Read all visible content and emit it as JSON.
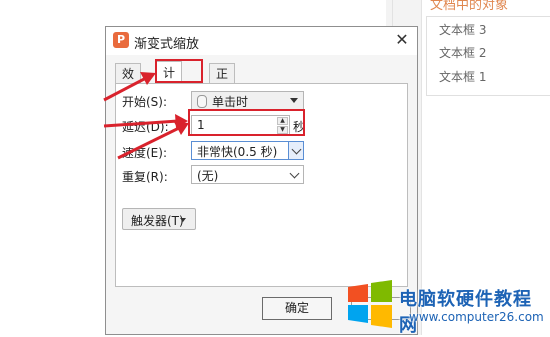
{
  "background": {
    "panel_title": "文档中的对象",
    "items": [
      "文本框 3",
      "文本框 2",
      "文本框 1"
    ]
  },
  "dialog": {
    "app_icon_glyph": "P",
    "title": "渐变式缩放",
    "close_glyph": "✕",
    "tabs": [
      {
        "label": "效果",
        "active": false
      },
      {
        "label": "计时",
        "active": true
      },
      {
        "label": "正文文本动画",
        "active": false
      }
    ],
    "start": {
      "label": "开始(S):",
      "value": "单击时"
    },
    "delay": {
      "label": "延迟(D):",
      "value": "1",
      "unit": "秒"
    },
    "speed": {
      "label": "速度(E):",
      "value": "非常快(0.5 秒)"
    },
    "repeat": {
      "label": "重复(R):",
      "value": "(无)"
    },
    "trigger_button": "触发器(T)",
    "ok_button": "确定"
  },
  "watermark": {
    "brand": "电脑软硬件教程网",
    "url": "www.computer26.com"
  },
  "colors": {
    "annotation": "#d9222c",
    "brand_blue": "#1d63b5",
    "app_orange": "#e96b3d"
  }
}
